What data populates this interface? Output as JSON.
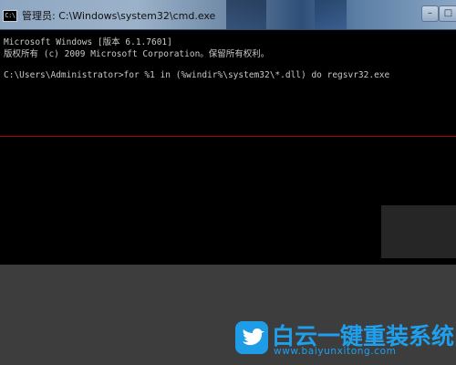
{
  "window": {
    "title": "管理员: C:\\Windows\\system32\\cmd.exe",
    "icon_label": "C:\\",
    "icon": "cmd-icon",
    "controls": {
      "minimize": "–",
      "maximize": "□",
      "close": "✕"
    }
  },
  "console": {
    "lines": [
      "Microsoft Windows [版本 6.1.7601]",
      "版权所有 (c) 2009 Microsoft Corporation。保留所有权利。",
      "",
      "C:\\Users\\Administrator>for %1 in (%windir%\\system32\\*.dll) do regsvr32.exe"
    ],
    "text_color": "#c8c8c8",
    "background": "#000000"
  },
  "watermark": {
    "brand": "白云一键重装系统",
    "url": "www.baiyunxitong.com",
    "icon": "bird-icon",
    "color": "#1ea0ee"
  }
}
